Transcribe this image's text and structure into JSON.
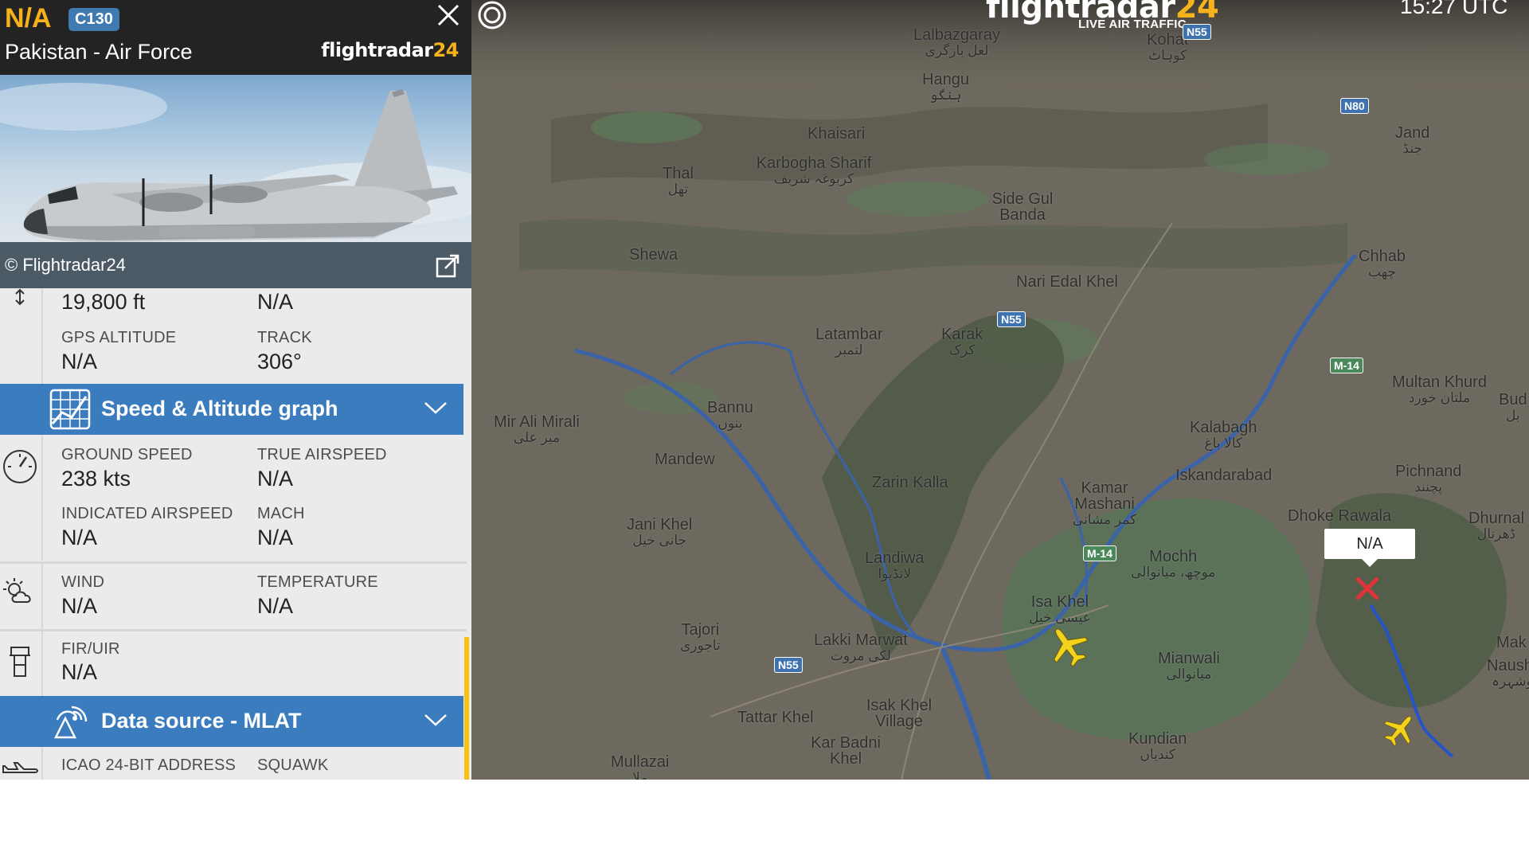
{
  "header": {
    "flight_id": "N/A",
    "aircraft_type": "C130",
    "airline": "Pakistan - Air Force",
    "brand_main": "flightradar",
    "brand_accent": "24"
  },
  "photo": {
    "credit": "© Flightradar24"
  },
  "altitude": {
    "baro_value": "19,800 ft",
    "vertical_speed_value": "N/A",
    "gps_label": "GPS ALTITUDE",
    "gps_value": "N/A",
    "track_label": "TRACK",
    "track_value": "306°"
  },
  "speed_graph_bar": {
    "title": "Speed & Altitude graph"
  },
  "speed": {
    "ground_speed_label": "GROUND SPEED",
    "ground_speed_value": "238 kts",
    "true_airspeed_label": "TRUE AIRSPEED",
    "true_airspeed_value": "N/A",
    "indicated_label": "INDICATED AIRSPEED",
    "indicated_value": "N/A",
    "mach_label": "MACH",
    "mach_value": "N/A"
  },
  "weather": {
    "wind_label": "WIND",
    "wind_value": "N/A",
    "temperature_label": "TEMPERATURE",
    "temperature_value": "N/A"
  },
  "fir": {
    "label": "FIR/UIR",
    "value": "N/A"
  },
  "datasource_bar": {
    "title": "Data source - MLAT"
  },
  "identity": {
    "icao_label": "ICAO 24-BIT ADDRESS",
    "squawk_label": "SQUAWK"
  },
  "map": {
    "logo_main": "flightradar",
    "logo_accent": "24",
    "logo_sub": "LIVE AIR TRAFFIC",
    "clock": "15:27 UTC",
    "tooltip": "N/A",
    "places": [
      {
        "name": "Lalbazgaray",
        "sub": "لعل بازگری"
      },
      {
        "name": "Kohat",
        "sub": "کوہاٹ"
      },
      {
        "name": "Hangu",
        "sub": "ہنگو"
      },
      {
        "name": "Khaisari",
        "sub": ""
      },
      {
        "name": "Karbogha Sharif",
        "sub": "کربوغہ شریف"
      },
      {
        "name": "Thal",
        "sub": "تھل"
      },
      {
        "name": "Side Gul Banda",
        "sub": ""
      },
      {
        "name": "Jand",
        "sub": "جنڈ"
      },
      {
        "name": "Shewa",
        "sub": ""
      },
      {
        "name": "Nari Edal Khel",
        "sub": ""
      },
      {
        "name": "Chhab",
        "sub": "چھب"
      },
      {
        "name": "Latambar",
        "sub": "لتمبر"
      },
      {
        "name": "Karak",
        "sub": "کرک"
      },
      {
        "name": "Multan Khurd",
        "sub": "ملتان خورد"
      },
      {
        "name": "Bud",
        "sub": "بل"
      },
      {
        "name": "Bannu",
        "sub": "بنوں"
      },
      {
        "name": "Mir Ali Mirali",
        "sub": "میر علی"
      },
      {
        "name": "Kalabagh",
        "sub": "کالا باغ"
      },
      {
        "name": "Mandew",
        "sub": ""
      },
      {
        "name": "Zarin Kalla",
        "sub": ""
      },
      {
        "name": "Kamar Mashani",
        "sub": "کمر مشانی"
      },
      {
        "name": "Iskandarabad",
        "sub": ""
      },
      {
        "name": "Pichnand",
        "sub": "پچنند"
      },
      {
        "name": "Dhoke Rawala",
        "sub": ""
      },
      {
        "name": "Dhurnal",
        "sub": "ڈھرنال"
      },
      {
        "name": "Jani Khel",
        "sub": "جانی خیل"
      },
      {
        "name": "Landiwa",
        "sub": "لانڈیوا"
      },
      {
        "name": "Mochh",
        "sub": "موچھ، میانوالی"
      },
      {
        "name": "Isa Khel",
        "sub": "عیسی خیل"
      },
      {
        "name": "Tajori",
        "sub": "تاجوری"
      },
      {
        "name": "Lakki Marwat",
        "sub": "لکی مروت"
      },
      {
        "name": "Mianwali",
        "sub": "میانوالی"
      },
      {
        "name": "Mak",
        "sub": ""
      },
      {
        "name": "Naushe",
        "sub": "نوشہرہ"
      },
      {
        "name": "Isak Khel Village",
        "sub": ""
      },
      {
        "name": "Tattar Khel",
        "sub": ""
      },
      {
        "name": "Kar Badni Khel",
        "sub": ""
      },
      {
        "name": "Kundian",
        "sub": "کندیاں"
      },
      {
        "name": "Mullazai",
        "sub": "ملا"
      }
    ],
    "roads": [
      "N55",
      "N80",
      "N55",
      "M-14",
      "M-14",
      "N55"
    ]
  }
}
